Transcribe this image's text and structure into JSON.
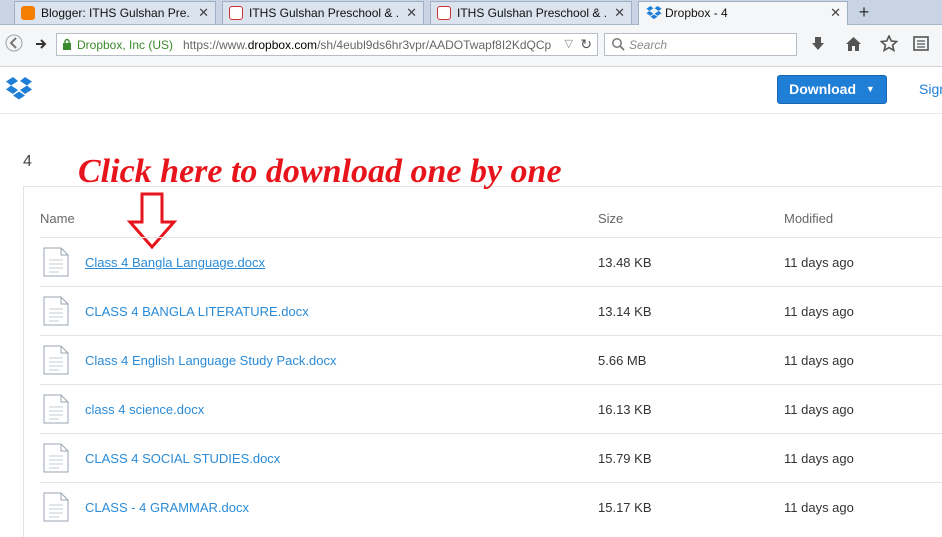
{
  "tabs": [
    {
      "title": "Blogger: ITHS Gulshan Pre...",
      "close": "✕"
    },
    {
      "title": "ITHS Gulshan Preschool & ...",
      "close": "✕"
    },
    {
      "title": "ITHS Gulshan Preschool & ...",
      "close": "✕"
    },
    {
      "title": "Dropbox - 4",
      "close": "✕"
    }
  ],
  "new_tab": "+",
  "nav": {
    "org": "Dropbox, Inc (US)",
    "url_prefix": "https://www.",
    "url_domain": "dropbox.com",
    "url_path": "/sh/4eubl9ds6hr3vpr/AADOTwapf8I2KdQCp",
    "search_placeholder": "Search"
  },
  "header": {
    "download_label": "Download",
    "download_caret": "▼",
    "signin_label": "Sign"
  },
  "folder_name": "4",
  "annotation": "Click here to download one by one",
  "columns": {
    "name": "Name",
    "size": "Size",
    "modified": "Modified"
  },
  "files": [
    {
      "name": "Class 4 Bangla Language.docx",
      "size": "13.48 KB",
      "modified": "11 days ago"
    },
    {
      "name": "CLASS 4 BANGLA LITERATURE.docx",
      "size": "13.14 KB",
      "modified": "11 days ago"
    },
    {
      "name": "Class 4 English Language Study Pack.docx",
      "size": "5.66 MB",
      "modified": "11 days ago"
    },
    {
      "name": "class 4 science.docx",
      "size": "16.13 KB",
      "modified": "11 days ago"
    },
    {
      "name": "CLASS 4 SOCIAL STUDIES.docx",
      "size": "15.79 KB",
      "modified": "11 days ago"
    },
    {
      "name": "CLASS - 4 GRAMMAR.docx",
      "size": "15.17 KB",
      "modified": "11 days ago"
    }
  ],
  "colors": {
    "accent": "#1f7fd6",
    "annotation": "#e8141b",
    "link": "#2a8bd8"
  }
}
